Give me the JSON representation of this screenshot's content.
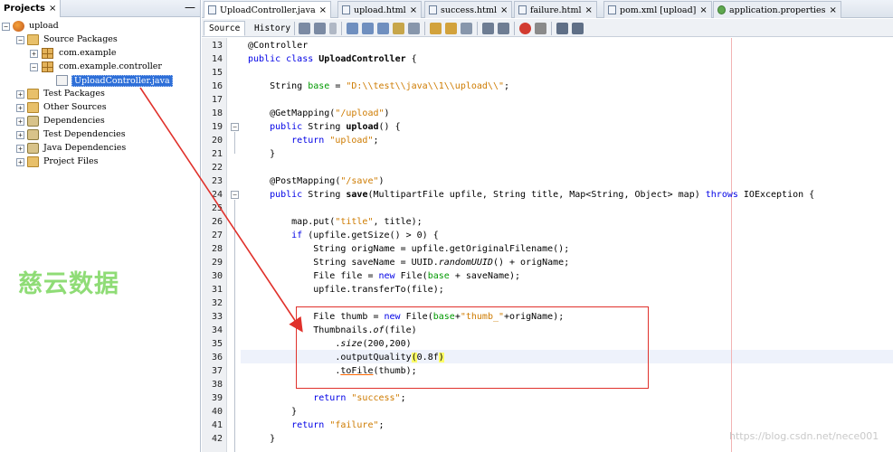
{
  "projects_panel": {
    "tab_label": "Projects",
    "tab_close": "×",
    "minimize": "—",
    "tree": [
      {
        "label": "upload",
        "expander": "−",
        "icon": "project-icon"
      },
      {
        "label": "Source Packages",
        "expander": "−",
        "icon": "folder-icon"
      },
      {
        "label": "com.example",
        "expander": "+",
        "icon": "package-icon"
      },
      {
        "label": "com.example.controller",
        "expander": "−",
        "icon": "package-icon"
      },
      {
        "label": "UploadController.java",
        "expander": "",
        "icon": "java-file-icon",
        "selected": true
      },
      {
        "label": "Test Packages",
        "expander": "+",
        "icon": "folder-icon"
      },
      {
        "label": "Other Sources",
        "expander": "+",
        "icon": "folder-icon"
      },
      {
        "label": "Dependencies",
        "expander": "+",
        "icon": "dependencies-icon"
      },
      {
        "label": "Test Dependencies",
        "expander": "+",
        "icon": "dependencies-icon"
      },
      {
        "label": "Java Dependencies",
        "expander": "+",
        "icon": "dependencies-icon"
      },
      {
        "label": "Project Files",
        "expander": "+",
        "icon": "folder-icon"
      }
    ]
  },
  "editor": {
    "tabs": [
      {
        "label": "UploadController.java",
        "close": "×",
        "icon": "java-file-icon",
        "active": true
      },
      {
        "label": "upload.html",
        "close": "×",
        "icon": "html-file-icon"
      },
      {
        "label": "success.html",
        "close": "×",
        "icon": "html-file-icon"
      },
      {
        "label": "failure.html",
        "close": "×",
        "icon": "html-file-icon"
      },
      {
        "label": "pom.xml [upload]",
        "close": "×",
        "icon": "maven-file-icon"
      },
      {
        "label": "application.properties",
        "close": "×",
        "icon": "spring-icon"
      }
    ],
    "view_tabs": {
      "source": "Source",
      "history": "History"
    },
    "toolbar_icons": [
      "back-icon",
      "forward-icon",
      "dropdown-icon",
      "find-previous-icon",
      "find-selection-icon",
      "find-next-icon",
      "toggle-highlight-icon",
      "toggle-rect-select-icon",
      "prev-bookmark-icon",
      "next-bookmark-icon",
      "toggle-bookmark-icon",
      "shift-left-icon",
      "shift-right-icon",
      "start-macro-icon",
      "stop-macro-icon",
      "comment-icon",
      "uncomment-icon"
    ],
    "line_numbers": [
      "13",
      "14",
      "15",
      "16",
      "17",
      "18",
      "19",
      "20",
      "21",
      "22",
      "23",
      "24",
      "25",
      "26",
      "27",
      "28",
      "29",
      "30",
      "31",
      "32",
      "33",
      "34",
      "35",
      "36",
      "37",
      "38",
      "39",
      "40",
      "41",
      "42"
    ],
    "code": {
      "l13": "@Controller",
      "l14a": "public class ",
      "l14b": "UploadController",
      "l14c": " {",
      "l16a": "    String ",
      "l16b": "base",
      "l16c": " = ",
      "l16d": "\"D:\\\\test\\\\java\\\\1\\\\upload\\\\\"",
      "l16e": ";",
      "l18a": "    @GetMapping(",
      "l18b": "\"/upload\"",
      "l18c": ")",
      "l19a": "    public ",
      "l19b": "String ",
      "l19c": "upload",
      "l19d": "() {",
      "l20a": "        return ",
      "l20b": "\"upload\"",
      "l20c": ";",
      "l21": "    }",
      "l23a": "    @PostMapping(",
      "l23b": "\"/save\"",
      "l23c": ")",
      "l24a": "    public ",
      "l24b": "String ",
      "l24c": "save",
      "l24d": "(MultipartFile upfile, String title, Map<String, Object> map) ",
      "l24e": "throws",
      "l24f": " IOException {",
      "l26a": "        map.put(",
      "l26b": "\"title\"",
      "l26c": ", title);",
      "l27a": "        if ",
      "l27b": "(upfile.getSize() > 0) {",
      "l28": "            String origName = upfile.getOriginalFilename();",
      "l29a": "            String saveName = UUID.",
      "l29b": "randomUUID",
      "l29c": "() + origName;",
      "l30a": "            File file = ",
      "l30b": "new ",
      "l30c": "File(",
      "l30d": "base",
      "l30e": " + saveName);",
      "l31": "            upfile.transferTo(file);",
      "l33a": "            File thumb = ",
      "l33b": "new ",
      "l33c": "File(",
      "l33d": "base",
      "l33e": "+",
      "l33f": "\"thumb_\"",
      "l33g": "+origName);",
      "l34a": "            Thumbnails.",
      "l34b": "of",
      "l34c": "(file)",
      "l35a": "                .",
      "l35b": "size",
      "l35c": "(200,200)",
      "l36a": "                .outputQuality",
      "l36b": "(",
      "l36c": "0.8f",
      "l36d": ")",
      "l37a": "                .",
      "l37b": "toFile",
      "l37c": "(thumb);",
      "l39a": "            return ",
      "l39b": "\"success\"",
      "l39c": ";",
      "l40": "        }",
      "l41a": "        return ",
      "l41b": "\"failure\"",
      "l41c": ";",
      "l42": "    }"
    }
  },
  "overlay": {
    "watermark_text": "慈云数据",
    "url_watermark": "https://blog.csdn.net/nece001",
    "annotation_color": "#e0312b"
  }
}
